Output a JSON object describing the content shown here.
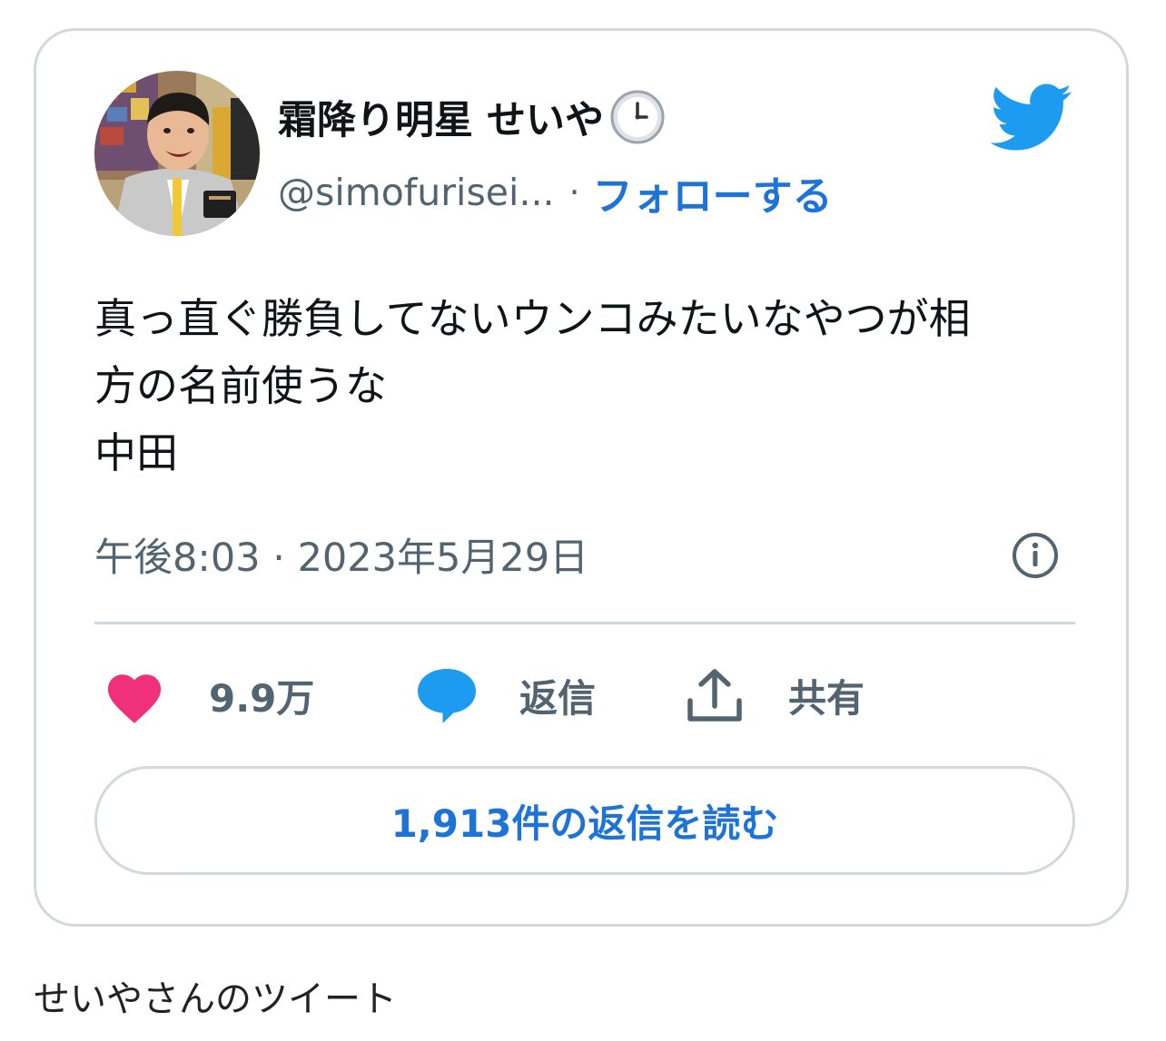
{
  "tweet": {
    "author": {
      "display_name": "霜降り明星 せいや",
      "badge_icon": "clock-icon",
      "handle": "@simofurisei...",
      "follow_label": "フォローする"
    },
    "text_lines": [
      "真っ直ぐ勝負してないウンコみたいなやつが相",
      "方の名前使うな",
      "中田"
    ],
    "timestamp": "午後8:03 · 2023年5月29日",
    "actions": {
      "like_count": "9.9万",
      "reply_label": "返信",
      "share_label": "共有"
    },
    "read_replies_label": "1,913件の返信を読む"
  },
  "caption": "せいやさんのツイート",
  "colors": {
    "accent": "#1d74d6",
    "twitter_blue": "#1d9bf0",
    "like_pink": "#f0307a",
    "muted_text": "#536471",
    "border": "#d3d8dd"
  }
}
